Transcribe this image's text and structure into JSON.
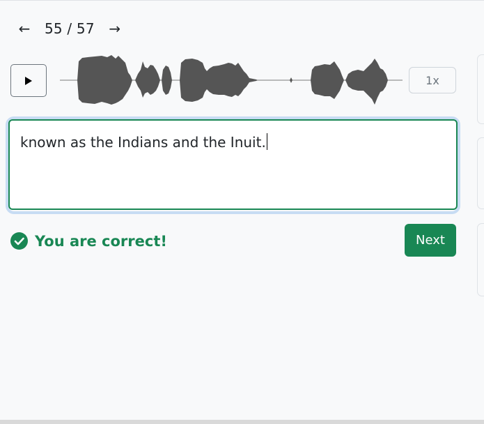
{
  "nav": {
    "prev_icon": "←",
    "counter": "55 / 57",
    "next_icon": "→"
  },
  "player": {
    "play_icon": "play-icon",
    "speed": "1x"
  },
  "answer": {
    "text": "known as the Indians and the Inuit."
  },
  "feedback": {
    "icon": "check-circle-icon",
    "message": "You are correct!"
  },
  "actions": {
    "next_label": "Next"
  },
  "colors": {
    "success": "#198754",
    "focus_ring": "#c7dcf3",
    "waveform": "#555555"
  }
}
